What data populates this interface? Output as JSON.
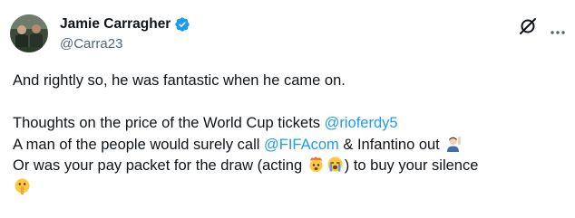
{
  "author": {
    "display_name": "Jamie Carragher",
    "handle": "@Carra23",
    "verified": true,
    "avatar_icon": "avatar-photo"
  },
  "header_icons": {
    "grok": "grok-icon",
    "more": "more-options-icon"
  },
  "tweet": {
    "line1": "And rightly so, he was fantastic when he came on.",
    "line2_text": "Thoughts on the price of the World Cup tickets ",
    "line2_mention": "@rioferdy5",
    "line3_text_a": "A man of the people would surely call ",
    "line3_mention": "@FIFAcom",
    "line3_text_b": " & Infantino out ",
    "line3_emoji": "man-raising-hand-emoji",
    "line4_text_a": "Or was your pay packet for the draw (acting ",
    "line4_emoji_1": "exploding-head-emoji",
    "line4_emoji_2": "loudly-crying-emoji",
    "line4_text_b": ") to buy your silence",
    "line5_emoji": "shushing-face-emoji"
  },
  "colors": {
    "text": "#0f1419",
    "secondary": "#536471",
    "link": "#1d9bf0",
    "verified": "#1d9bf0"
  }
}
